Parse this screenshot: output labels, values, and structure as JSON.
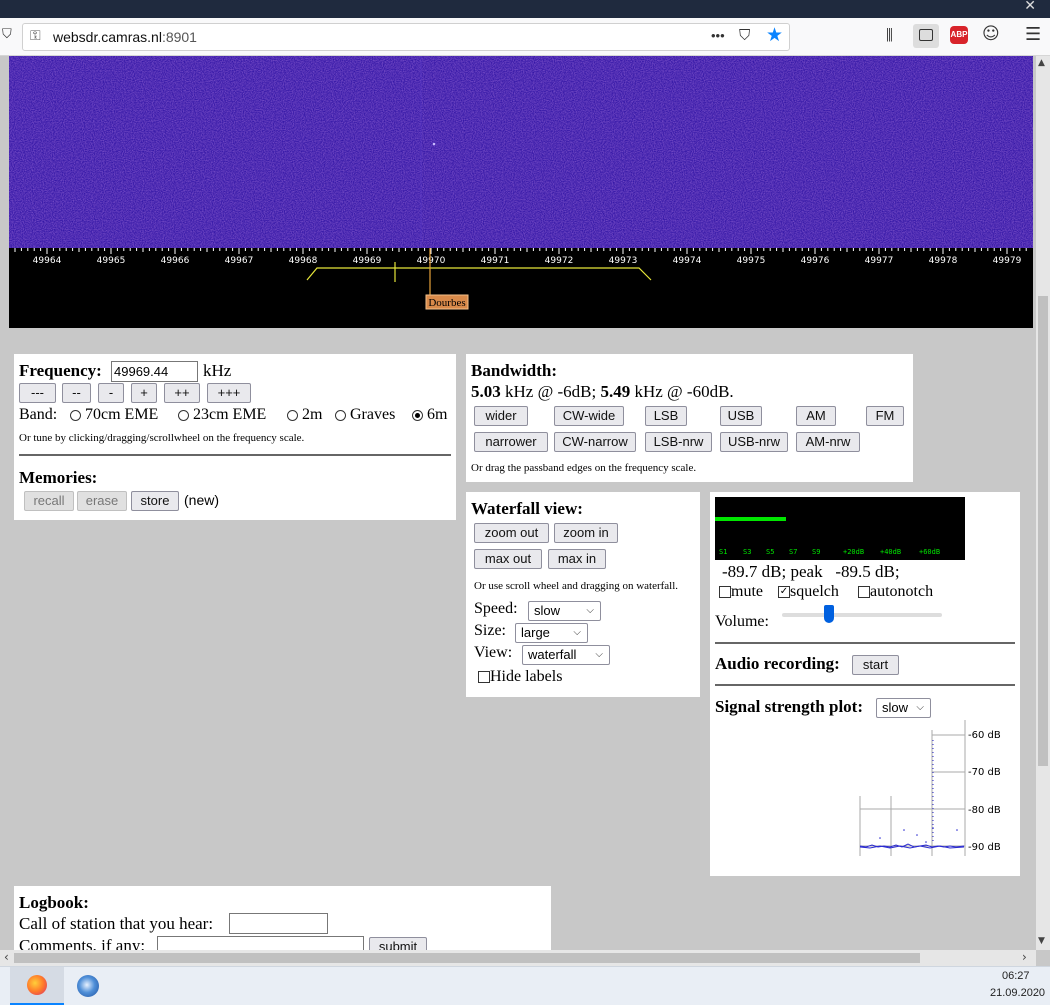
{
  "browser": {
    "url_domain": "websdr.camras.nl",
    "url_port": ":8901",
    "menu_dots": "•••"
  },
  "scale": {
    "ticks": [
      "49964",
      "49965",
      "49966",
      "49967",
      "49968",
      "49969",
      "49970",
      "49971",
      "49972",
      "49973",
      "49974",
      "49975",
      "49976",
      "49977",
      "49978",
      "49979"
    ],
    "station_label": "Dourbes"
  },
  "frequency": {
    "label": "Frequency:",
    "value": "49969.44",
    "unit": "kHz",
    "step_buttons": [
      "---",
      "--",
      "-",
      "+",
      "++",
      "+++"
    ],
    "band_label": "Band:",
    "bands": [
      {
        "name": "70cm EME",
        "selected": false
      },
      {
        "name": "23cm EME",
        "selected": false
      },
      {
        "name": "2m",
        "selected": false
      },
      {
        "name": "Graves",
        "selected": false
      },
      {
        "name": "6m",
        "selected": true
      }
    ],
    "hint": "Or tune by clicking/dragging/scrollwheel on the frequency scale."
  },
  "memories": {
    "title": "Memories:",
    "recall": "recall",
    "erase": "erase",
    "store": "store",
    "status": "(new)"
  },
  "bandwidth": {
    "title": "Bandwidth:",
    "bw6": "5.03",
    "bw6_text": " kHz @ -6dB; ",
    "bw60": "5.49",
    "bw60_text": " kHz @ -60dB.",
    "row1": [
      "wider",
      "CW-wide",
      "LSB",
      "USB",
      "AM",
      "FM"
    ],
    "row2": [
      "narrower",
      "CW-narrow",
      "LSB-nrw",
      "USB-nrw",
      "AM-nrw"
    ],
    "hint": "Or drag the passband edges on the frequency scale."
  },
  "waterfall_view": {
    "title": "Waterfall view:",
    "zoom_out": "zoom out",
    "zoom_in": "zoom in",
    "max_out": "max out",
    "max_in": "max in",
    "hint": "Or use scroll wheel and dragging on waterfall.",
    "speed_label": "Speed:",
    "speed_value": "slow",
    "size_label": "Size:",
    "size_value": "large",
    "view_label": "View:",
    "view_value": "waterfall",
    "hide_labels": "Hide labels"
  },
  "audio": {
    "meter_labels": [
      "S1",
      "S3",
      "S5",
      "S7",
      "S9",
      "+20dB",
      "+40dB",
      "+60dB"
    ],
    "level_text": "-89.7 dB; peak   -89.5 dB;",
    "mute": "mute",
    "squelch": "squelch",
    "squelch_checked": true,
    "autonotch": "autonotch",
    "volume_label": "Volume:",
    "volume_level": 0.28,
    "recording_label": "Audio recording:",
    "start": "start",
    "plot_label": "Signal strength plot:",
    "plot_speed": "slow",
    "plot_axis": [
      "-60 dB",
      "-70 dB",
      "-80 dB",
      "-90 dB"
    ]
  },
  "logbook": {
    "title": "Logbook:",
    "call_label": "Call of station that you hear:",
    "comments_label": "Comments, if any:",
    "submit": "submit"
  },
  "taskbar": {
    "time": "06:27",
    "date": "21.09.2020"
  },
  "colors": {
    "waterfall_bg": "#3a1fa8",
    "passband": "#e6e63a",
    "station_tag": "#d98a4a",
    "meter_bar": "#00e600"
  }
}
